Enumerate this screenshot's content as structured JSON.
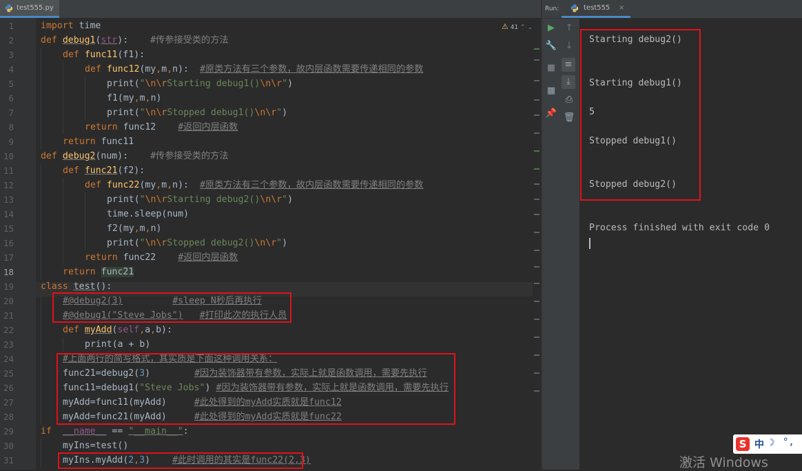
{
  "editor_tab": {
    "label": "test555.py"
  },
  "run_panel": {
    "label": "Run:",
    "tab": "test555"
  },
  "inspection": {
    "count": "41"
  },
  "line_numbers": [
    "1",
    "2",
    "3",
    "4",
    "5",
    "6",
    "7",
    "8",
    "9",
    "10",
    "11",
    "12",
    "13",
    "14",
    "15",
    "16",
    "17",
    "18",
    "19",
    "20",
    "21",
    "22",
    "23",
    "24",
    "25",
    "26",
    "27",
    "28",
    "29",
    "30",
    "31"
  ],
  "code": {
    "l1_a": "import",
    "l1_b": " time",
    "l2_a": "def",
    "l2_b": "debug1",
    "l2_c": "(",
    "l2_d": "str",
    "l2_e": "):",
    "l2_f": "#传参接受类的方法",
    "l3_a": "def",
    "l3_b": "func11",
    "l3_c": "(f1):",
    "l4_a": "def",
    "l4_b": "func12",
    "l4_c": "(my",
    "l4_d": ",",
    "l4_e": "m",
    "l4_f": ",",
    "l4_g": "n):",
    "l4_h": "#原类方法有三个参数，故内层函数需要传递相同的参数",
    "l5_a": "print(",
    "l5_b": "\"",
    "l5_c": "\\n\\r",
    "l5_d": "Starting debug1()",
    "l5_e": "\\n\\r",
    "l5_f": "\"",
    "l5_g": ")",
    "l6_a": "f1(my",
    "l6_b": ",",
    "l6_c": "m",
    "l6_d": ",",
    "l6_e": "n)",
    "l7_a": "print(",
    "l7_b": "\"",
    "l7_c": "\\n\\r",
    "l7_d": "Stopped debug1()",
    "l7_e": "\\n\\r",
    "l7_f": "\"",
    "l7_g": ")",
    "l8_a": "return",
    "l8_b": " func12",
    "l8_c": "#返回内层函数",
    "l9_a": "return",
    "l9_b": " func11",
    "l10_a": "def",
    "l10_b": "debug2",
    "l10_c": "(num):",
    "l10_d": "#传参接受类的方法",
    "l11_a": "def",
    "l11_b": "func21",
    "l11_c": "(f2):",
    "l12_a": "def",
    "l12_b": "func22",
    "l12_c": "(my",
    "l12_d": ",",
    "l12_e": "m",
    "l12_f": ",",
    "l12_g": "n):",
    "l12_h": "#原类方法有三个参数，故内层函数需要传递相同的参数",
    "l13_a": "print(",
    "l13_b": "\"",
    "l13_c": "\\n\\r",
    "l13_d": "Starting debug2()",
    "l13_e": "\\n\\r",
    "l13_f": "\"",
    "l13_g": ")",
    "l14_a": "time.sleep(num)",
    "l15_a": "f2(my",
    "l15_b": ",",
    "l15_c": "m",
    "l15_d": ",",
    "l15_e": "n)",
    "l16_a": "print(",
    "l16_b": "\"",
    "l16_c": "\\n\\r",
    "l16_d": "Stopped debug2()",
    "l16_e": "\\n\\r",
    "l16_f": "\"",
    "l16_g": ")",
    "l17_a": "return",
    "l17_b": " func22",
    "l17_c": "#返回内层函数",
    "l18_a": "return",
    "l18_b": "func21",
    "l19_a": "class",
    "l19_b": "test",
    "l19_c": "():",
    "l20_a": "#@debug2(3)",
    "l20_b": "#sleep N秒后再执行",
    "l21_a": "#@debug1(\"Steve Jobs\")",
    "l21_b": "#打印此次的执行人员",
    "l22_a": "def",
    "l22_b": "myAdd",
    "l22_c": "(",
    "l22_d": "self",
    "l22_e": ",",
    "l22_f": "a",
    "l22_g": ",",
    "l22_h": "b):",
    "l23_a": "print(a + b)",
    "l24_a": "#上面两行的简写格式，其实质是下面这种调用关系：",
    "l25_a": "func21=debug2(",
    "l25_b": "3",
    "l25_c": ")",
    "l25_d": "#因为装饰器带有参数，实际上就是函数调用，需要先执行",
    "l26_a": "func11=debug1(",
    "l26_b": "\"Steve Jobs\"",
    "l26_c": ")",
    "l26_d": "#因为装饰器带有参数，实际上就是函数调用，需要先执行",
    "l27_a": "myAdd=func11(myAdd)",
    "l27_b": "#此处得到的myAdd实质就是func12",
    "l28_a": "myAdd=func21(myAdd)",
    "l28_b": "#此处得到的myAdd实质就是func22",
    "l29_a": "if",
    "l29_b": "__name__",
    "l29_c": "==",
    "l29_d": "\"__main__\"",
    "l29_e": ":",
    "l30_a": "myIns=test()",
    "l31_a": "myIns.myAdd(",
    "l31_b": "2",
    "l31_c": ",",
    "l31_d": "3",
    "l31_e": ")",
    "l31_f": "#此时调用的其实是func22(2,3)"
  },
  "console": {
    "lines": [
      "Starting debug2()",
      "Starting debug1()",
      "5",
      "Stopped debug1()",
      "Stopped debug2()",
      "Process finished with exit code 0"
    ]
  },
  "watermark": "激活 Windows",
  "ime": {
    "logo": "S",
    "lang": "中"
  }
}
